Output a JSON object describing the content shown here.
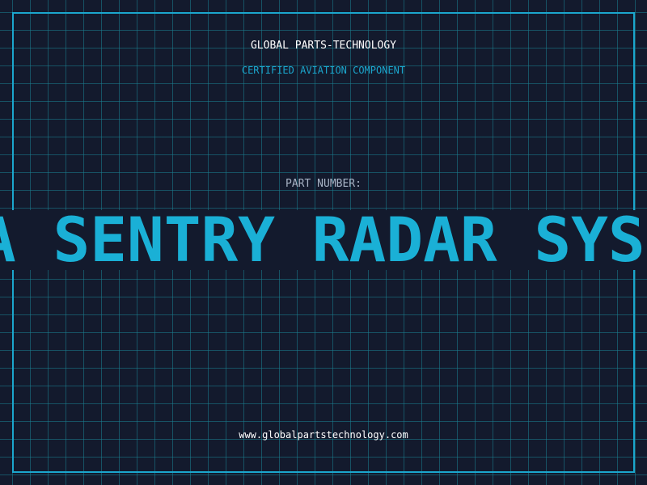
{
  "header": {
    "company": "GLOBAL PARTS-TECHNOLOGY",
    "tagline": "CERTIFIED AVIATION COMPONENT"
  },
  "part": {
    "label": "PART NUMBER:",
    "marquee_text": "A SENTRY RADAR SYST"
  },
  "footer": {
    "url": "www.globalpartstechnology.com"
  },
  "colors": {
    "background": "#131a2d",
    "accent": "#1ba6cd",
    "grid": "#1e7f90",
    "label": "#a9b4c6",
    "text": "#ffffff"
  }
}
